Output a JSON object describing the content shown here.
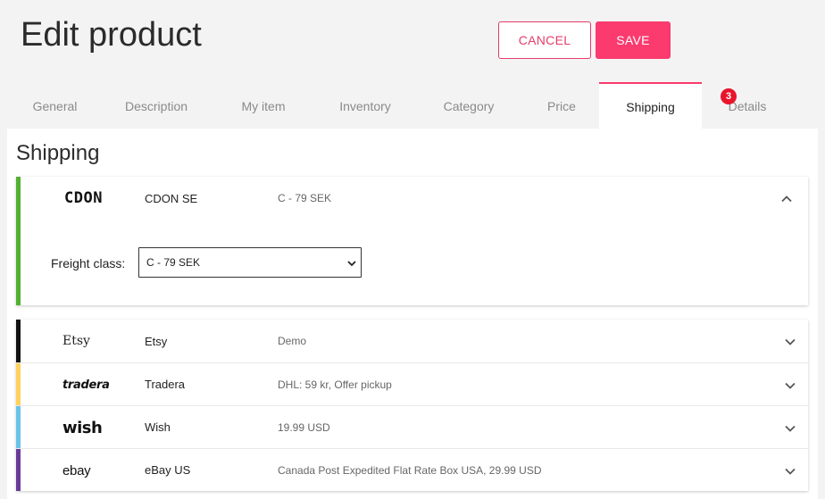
{
  "header": {
    "title": "Edit product",
    "cancel_label": "CANCEL",
    "save_label": "SAVE"
  },
  "tabs": [
    {
      "label": "General"
    },
    {
      "label": "Description"
    },
    {
      "label": "My item"
    },
    {
      "label": "Inventory"
    },
    {
      "label": "Category"
    },
    {
      "label": "Price"
    },
    {
      "label": "Shipping",
      "active": true
    },
    {
      "label": "Details",
      "badge": "3"
    }
  ],
  "shipping": {
    "title": "Shipping",
    "expanded": {
      "logo": "CDON",
      "name": "CDON SE",
      "info": "C - 79 SEK",
      "accent": "#52b033",
      "freight_label": "Freight class:",
      "freight_value": "C - 79 SEK"
    },
    "channels": [
      {
        "logo": "Etsy",
        "name": "Etsy",
        "info": "Demo",
        "accent": "#111111"
      },
      {
        "logo": "tradera",
        "name": "Tradera",
        "info": "DHL: 59 kr, Offer pickup",
        "accent": "#ffd25c"
      },
      {
        "logo": "wish",
        "name": "Wish",
        "info": "19.99 USD",
        "accent": "#6cc3ea"
      },
      {
        "logo": "ebay",
        "name": "eBay US",
        "info": "Canada Post Expedited Flat Rate Box USA, 29.99 USD",
        "accent": "#6b3a99"
      }
    ]
  },
  "colors": {
    "primary": "#fb3a6e",
    "badge": "#e8152d"
  }
}
